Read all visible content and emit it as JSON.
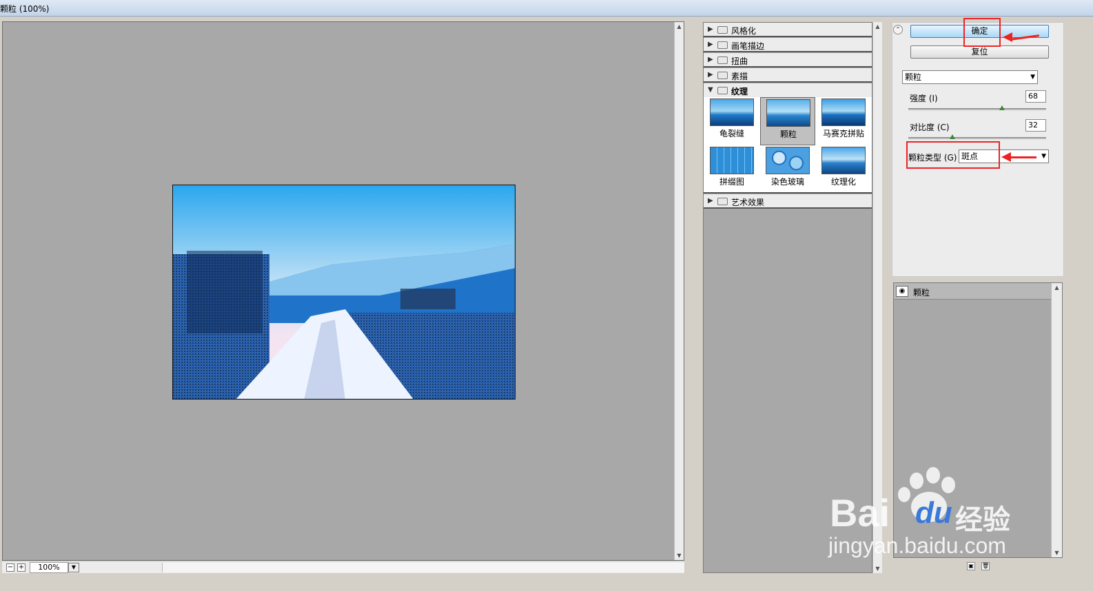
{
  "window": {
    "title": "颗粒 (100%)"
  },
  "preview": {
    "zoom": "100%",
    "zoom_out_icon": "minus-icon",
    "zoom_in_icon": "plus-icon"
  },
  "filter_list": {
    "categories": [
      {
        "label": "风格化",
        "expanded": false
      },
      {
        "label": "画笔描边",
        "expanded": false
      },
      {
        "label": "扭曲",
        "expanded": false
      },
      {
        "label": "素描",
        "expanded": false
      },
      {
        "label": "纹理",
        "expanded": true
      },
      {
        "label": "艺术效果",
        "expanded": false
      }
    ],
    "texture_filters": [
      {
        "label": "龟裂缝",
        "selected": false
      },
      {
        "label": "颗粒",
        "selected": true
      },
      {
        "label": "马赛克拼贴",
        "selected": false
      },
      {
        "label": "拼缀图",
        "selected": false
      },
      {
        "label": "染色玻璃",
        "selected": false
      },
      {
        "label": "纹理化",
        "selected": false
      }
    ]
  },
  "controls": {
    "ok_label": "确定",
    "reset_label": "复位",
    "filter_select": "颗粒",
    "intensity_label": "强度 (I)",
    "intensity_value": "68",
    "intensity_level": 68,
    "contrast_label": "对比度 (C)",
    "contrast_value": "32",
    "contrast_level": 32,
    "grain_type_label": "颗粒类型 (G) :",
    "grain_type_value": "斑点"
  },
  "layers": {
    "items": [
      {
        "label": "颗粒",
        "visible": true
      }
    ]
  },
  "watermark": {
    "brand": "Bai",
    "brand2": "du",
    "brand_cn": "经验",
    "url": "jingyan.baidu.com"
  },
  "colors": {
    "annotation": "#ee2222",
    "primary_button": "#a9d7f5",
    "canvas": "#a8a8a8"
  }
}
